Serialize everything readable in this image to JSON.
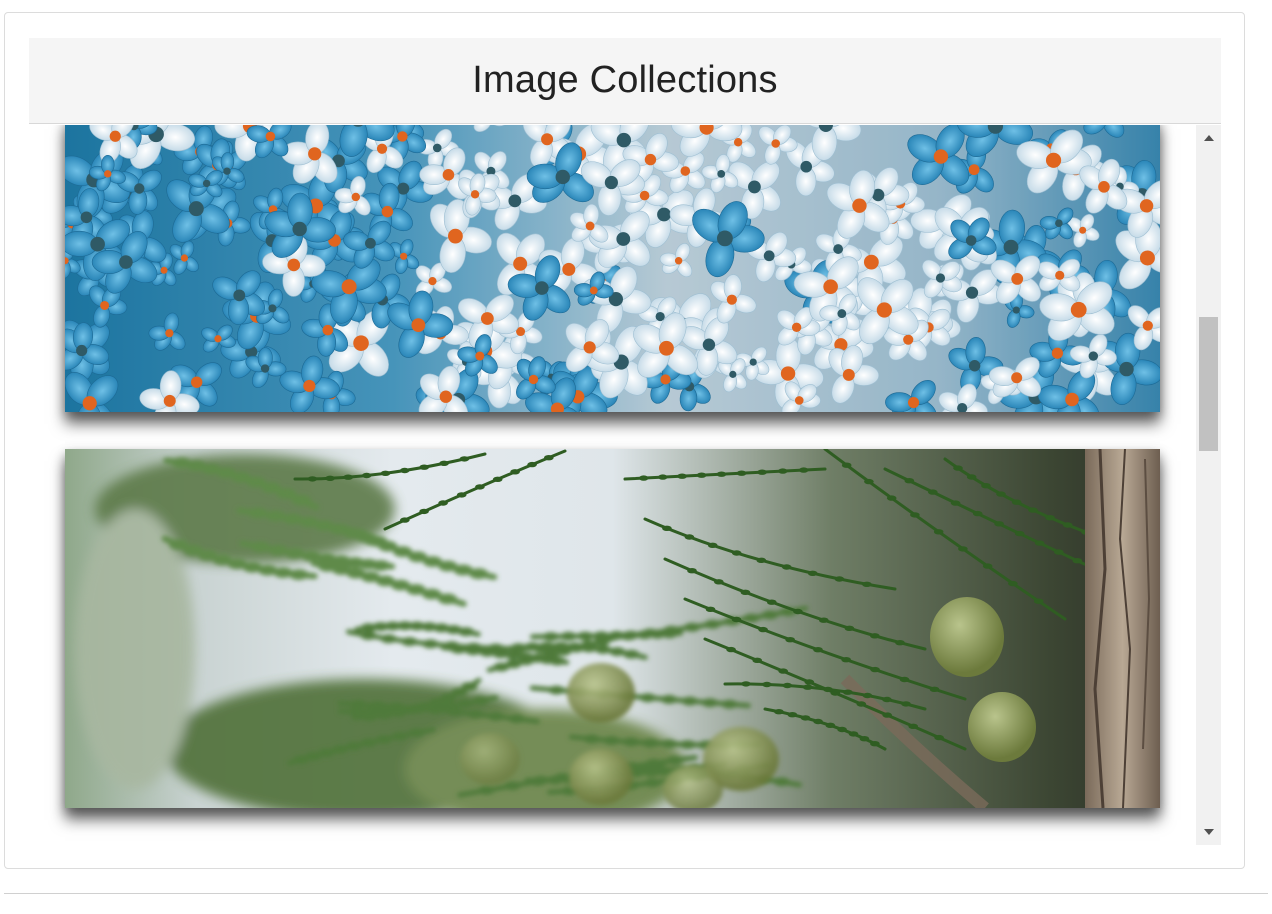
{
  "header": {
    "title": "Image Collections"
  },
  "gallery": {
    "images": [
      {
        "subject": "white and blue flowers with orange stamens"
      },
      {
        "subject": "conifer branch with green berries"
      }
    ]
  },
  "colors": {
    "header_bg": "#f5f5f5",
    "scrollbar_track": "#f1f1f1",
    "scrollbar_thumb": "#c1c1c1"
  },
  "scrollbar": {
    "position": 0.42
  }
}
